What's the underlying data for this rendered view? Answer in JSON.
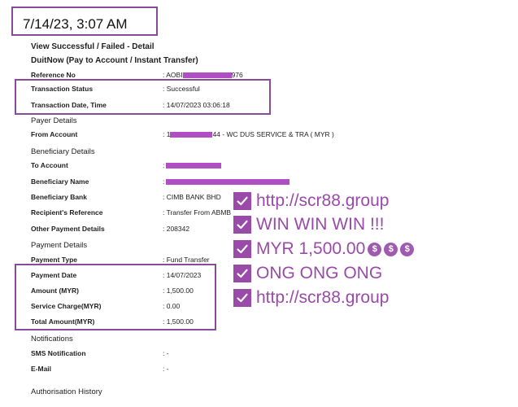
{
  "header": {
    "date_time": "7/14/23, 3:07 AM",
    "title": "View Successful / Failed - Detail",
    "subtitle": "DuitNow (Pay to Account / Instant Transfer)"
  },
  "reference": {
    "label": "Reference No",
    "value_prefix": ": AOBI",
    "value_suffix": "976"
  },
  "status": {
    "status_label": "Transaction Status",
    "status_value": ": Successful",
    "datetime_label": "Transaction Date, Time",
    "datetime_value": ": 14/07/2023 03:06:18"
  },
  "payer": {
    "section": "Payer Details",
    "from_label": "From Account",
    "from_prefix": ": 1",
    "from_suffix": "44 - WC DUS SERVICE & TRA ( MYR )"
  },
  "beneficiary": {
    "section": "Beneficiary Details",
    "to_label": "To Account",
    "to_prefix": ":",
    "name_label": "Beneficiary Name",
    "name_prefix": ":",
    "bank_label": "Beneficiary Bank",
    "bank_value": ": CIMB BANK BHD",
    "ref_label": "Recipient's Reference",
    "ref_value": ": Transfer From ABMB",
    "other_label": "Other Payment Details",
    "other_value": ": 208342"
  },
  "payment": {
    "section": "Payment Details",
    "type_label": "Payment Type",
    "type_value": ": Fund Transfer",
    "date_label": "Payment Date",
    "date_value": ": 14/07/2023",
    "amount_label": "Amount (MYR)",
    "amount_value": ": 1,500.00",
    "charge_label": "Service Charge(MYR)",
    "charge_value": ": 0.00",
    "total_label": "Total Amount(MYR)",
    "total_value": ": 1,500.00"
  },
  "notifications": {
    "section": "Notifications",
    "sms_label": "SMS Notification",
    "sms_value": ": -",
    "email_label": "E-Mail",
    "email_value": ": -"
  },
  "authorisation": {
    "section": "Authorisation History"
  },
  "promo": {
    "lines": [
      "http://scr88.group",
      "WIN WIN WIN !!!",
      "MYR 1,500.00",
      "ONG ONG ONG",
      "http://scr88.group"
    ],
    "bag_glyph": "$"
  },
  "colors": {
    "accent": "#9a4aa8",
    "redaction": "#b04fc4",
    "box": "#8a4a9c"
  }
}
